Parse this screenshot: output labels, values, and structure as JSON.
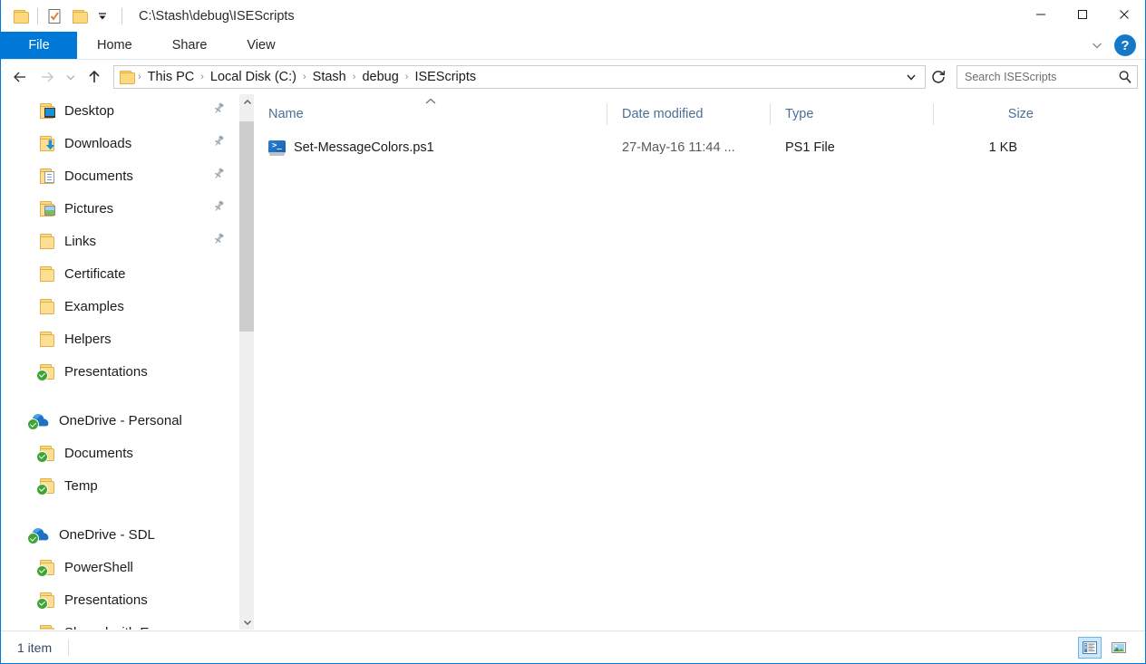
{
  "window": {
    "path_title": "C:\\Stash\\debug\\ISEScripts",
    "accent_color": "#0078d7"
  },
  "quick_access_toolbar": {
    "items": [
      {
        "name": "properties-icon",
        "label": "Properties"
      },
      {
        "name": "new-folder-icon",
        "label": "New folder"
      }
    ],
    "customize_label": "Customize Quick Access Toolbar"
  },
  "window_controls": {
    "minimize": "─",
    "maximize": "☐",
    "close": "✕"
  },
  "ribbon": {
    "tabs": [
      {
        "id": "file",
        "label": "File",
        "selected": true
      },
      {
        "id": "home",
        "label": "Home",
        "selected": false
      },
      {
        "id": "share",
        "label": "Share",
        "selected": false
      },
      {
        "id": "view",
        "label": "View",
        "selected": false
      }
    ],
    "expand_label": "Expand the Ribbon",
    "help_label": "?"
  },
  "address_bar": {
    "back_label": "Back",
    "forward_label": "Forward",
    "recent_label": "Recent locations",
    "up_label": "Up one level",
    "breadcrumbs": [
      "This PC",
      "Local Disk (C:)",
      "Stash",
      "debug",
      "ISEScripts"
    ],
    "separator": "›",
    "dropdown_label": "Previous locations",
    "refresh_label": "Refresh"
  },
  "search": {
    "placeholder": "Search ISEScripts"
  },
  "nav_pane": {
    "groups": [
      {
        "type": "quick-access",
        "items": [
          {
            "label": "Desktop",
            "icon": "folder-desktop-icon",
            "pinned": true,
            "synced": false,
            "root": false
          },
          {
            "label": "Downloads",
            "icon": "folder-download-icon",
            "pinned": true,
            "synced": false,
            "root": false
          },
          {
            "label": "Documents",
            "icon": "folder-document-icon",
            "pinned": true,
            "synced": false,
            "root": false
          },
          {
            "label": "Pictures",
            "icon": "folder-picture-icon",
            "pinned": true,
            "synced": false,
            "root": false
          },
          {
            "label": "Links",
            "icon": "folder-icon",
            "pinned": true,
            "synced": false,
            "root": false
          },
          {
            "label": "Certificate",
            "icon": "folder-icon",
            "pinned": false,
            "synced": false,
            "root": false
          },
          {
            "label": "Examples",
            "icon": "folder-icon",
            "pinned": false,
            "synced": false,
            "root": false
          },
          {
            "label": "Helpers",
            "icon": "folder-icon",
            "pinned": false,
            "synced": false,
            "root": false
          },
          {
            "label": "Presentations",
            "icon": "folder-icon",
            "pinned": false,
            "synced": true,
            "root": false
          }
        ]
      },
      {
        "type": "onedrive-personal",
        "items": [
          {
            "label": "OneDrive - Personal",
            "icon": "onedrive-cloud-icon",
            "pinned": false,
            "synced": true,
            "root": true
          },
          {
            "label": "Documents",
            "icon": "folder-icon",
            "pinned": false,
            "synced": true,
            "root": false
          },
          {
            "label": "Temp",
            "icon": "folder-icon",
            "pinned": false,
            "synced": true,
            "root": false
          }
        ]
      },
      {
        "type": "onedrive-sdl",
        "items": [
          {
            "label": "OneDrive - SDL",
            "icon": "onedrive-cloud-icon",
            "pinned": false,
            "synced": true,
            "root": true
          },
          {
            "label": "PowerShell",
            "icon": "folder-icon",
            "pinned": false,
            "synced": true,
            "root": false
          },
          {
            "label": "Presentations",
            "icon": "folder-icon",
            "pinned": false,
            "synced": true,
            "root": false
          },
          {
            "label": "Shared with Everyone",
            "icon": "folder-icon",
            "pinned": false,
            "synced": true,
            "root": false
          }
        ]
      }
    ],
    "scrollbar": {
      "up_arrow": "⌃",
      "down_arrow": "⌄"
    }
  },
  "file_list": {
    "columns": [
      {
        "key": "name",
        "label": "Name",
        "sorted": "asc"
      },
      {
        "key": "date",
        "label": "Date modified",
        "sorted": ""
      },
      {
        "key": "type",
        "label": "Type",
        "sorted": ""
      },
      {
        "key": "size",
        "label": "Size",
        "sorted": ""
      }
    ],
    "rows": [
      {
        "name": "Set-MessageColors.ps1",
        "date": "27-May-16 11:44 ...",
        "type": "PS1 File",
        "size": "1 KB",
        "icon": "powershell-script-icon"
      }
    ]
  },
  "status_bar": {
    "count_text": "1 item",
    "views": [
      {
        "id": "details",
        "label": "Details view",
        "active": true
      },
      {
        "id": "large-icons",
        "label": "Large icons view",
        "active": false
      }
    ]
  }
}
